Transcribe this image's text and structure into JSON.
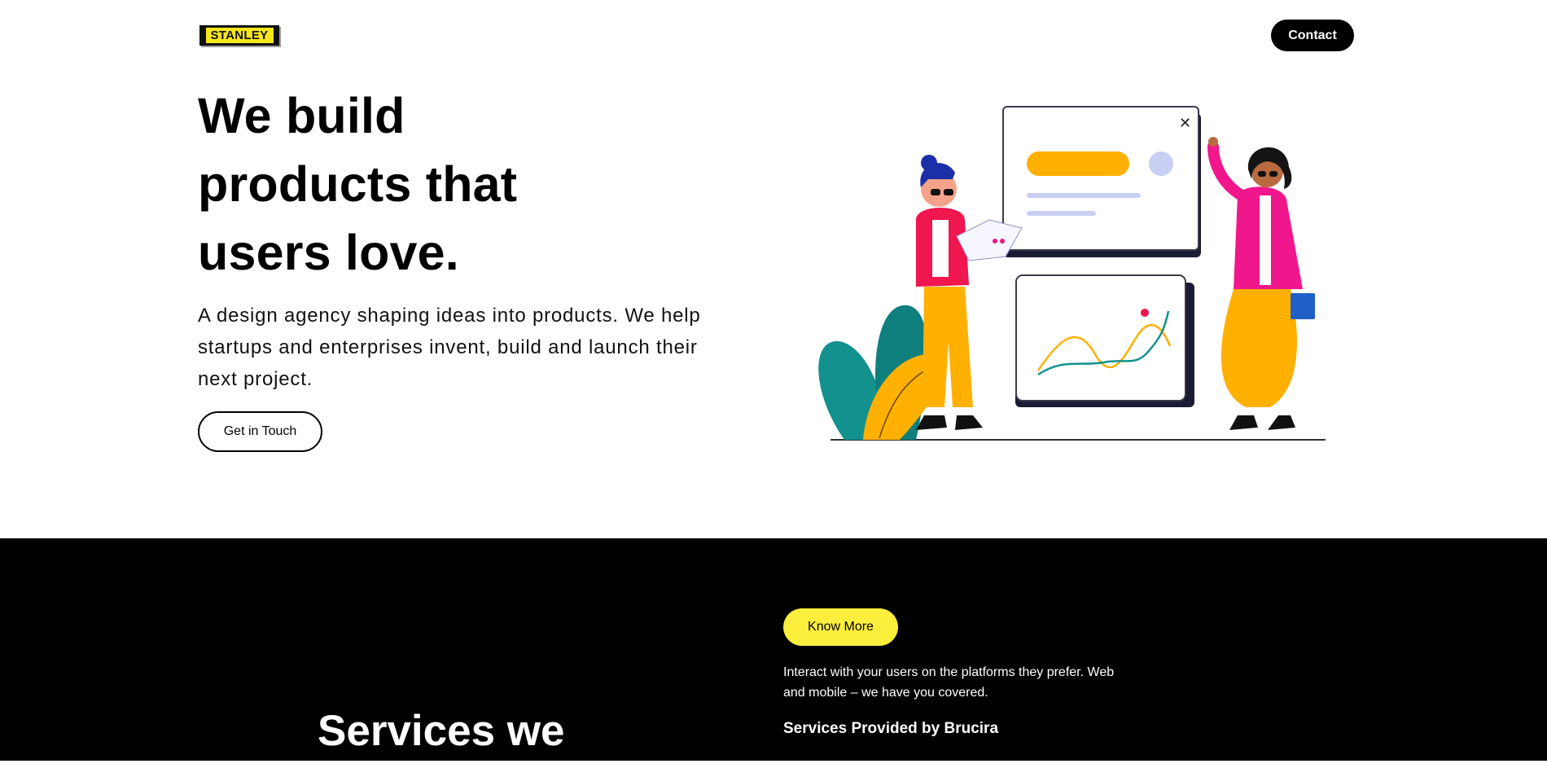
{
  "header": {
    "logo_text": "STANLEY",
    "contact_label": "Contact"
  },
  "hero": {
    "title_line1": "We build",
    "title_line2": "products that",
    "title_line3": "users love.",
    "description": "A design agency shaping ideas into products. We help startups and enterprises invent, build and launch their next project.",
    "cta_label": "Get in Touch"
  },
  "illustration": {
    "close_glyph": "✕"
  },
  "services": {
    "title_line1": "Services we",
    "know_more_label": "Know More",
    "interact_text": "Interact with your users on the platforms they prefer. Web and mobile – we have you covered.",
    "provided_heading": "Services Provided by Brucira"
  },
  "colors": {
    "brand_yellow": "#fbee3c",
    "logo_yellow": "#f8e71c",
    "accent_orange": "#ffb000",
    "accent_pink": "#f0168c",
    "accent_teal": "#12918f",
    "dark_bg": "#000000"
  }
}
